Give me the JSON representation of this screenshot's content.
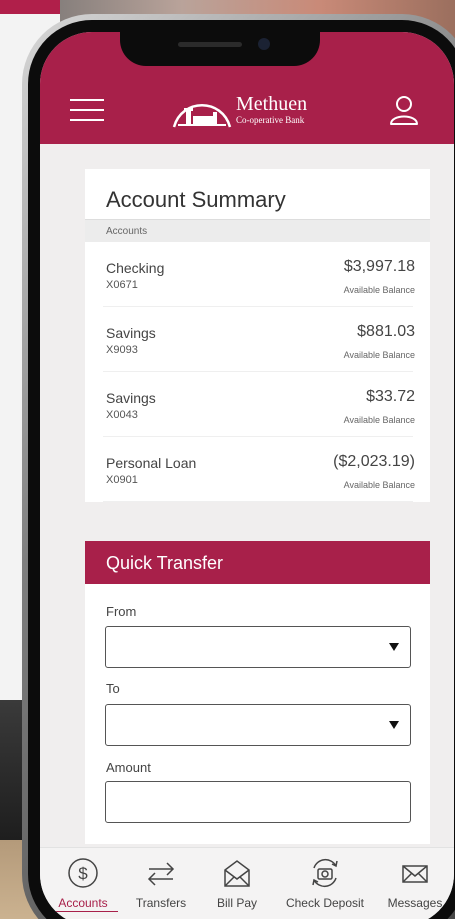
{
  "header": {
    "bank_name": "Methuen",
    "bank_sub": "Co-operative Bank"
  },
  "summary": {
    "title": "Account Summary",
    "section_label": "Accounts",
    "balance_label": "Available Balance",
    "accounts": [
      {
        "name": "Checking",
        "number": "X0671",
        "balance": "$3,997.18"
      },
      {
        "name": "Savings",
        "number": "X9093",
        "balance": "$881.03"
      },
      {
        "name": "Savings",
        "number": "X0043",
        "balance": "$33.72"
      },
      {
        "name": "Personal Loan",
        "number": "X0901",
        "balance": "($2,023.19)"
      }
    ]
  },
  "quick_transfer": {
    "title": "Quick Transfer",
    "from_label": "From",
    "to_label": "To",
    "amount_label": "Amount",
    "from_value": "",
    "to_value": "",
    "amount_value": ""
  },
  "nav": {
    "items": [
      {
        "label": "Accounts",
        "icon": "dollar-circle-icon"
      },
      {
        "label": "Transfers",
        "icon": "arrows-swap-icon"
      },
      {
        "label": "Bill Pay",
        "icon": "envelope-open-icon"
      },
      {
        "label": "Check Deposit",
        "icon": "camera-refresh-icon"
      },
      {
        "label": "Messages",
        "icon": "envelope-icon"
      }
    ],
    "active": "Accounts"
  },
  "colors": {
    "brand": "#a8204a",
    "text": "#444444"
  }
}
